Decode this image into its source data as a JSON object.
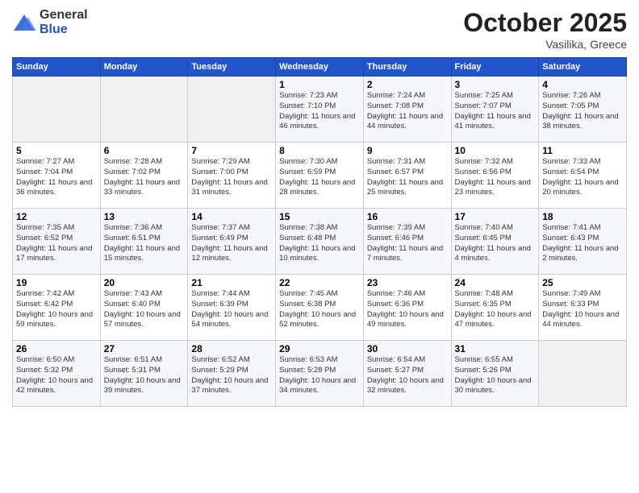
{
  "header": {
    "logo_general": "General",
    "logo_blue": "Blue",
    "month": "October 2025",
    "location": "Vasilika, Greece"
  },
  "weekdays": [
    "Sunday",
    "Monday",
    "Tuesday",
    "Wednesday",
    "Thursday",
    "Friday",
    "Saturday"
  ],
  "weeks": [
    [
      {
        "day": "",
        "sunrise": "",
        "sunset": "",
        "daylight": ""
      },
      {
        "day": "",
        "sunrise": "",
        "sunset": "",
        "daylight": ""
      },
      {
        "day": "",
        "sunrise": "",
        "sunset": "",
        "daylight": ""
      },
      {
        "day": "1",
        "sunrise": "Sunrise: 7:23 AM",
        "sunset": "Sunset: 7:10 PM",
        "daylight": "Daylight: 11 hours and 46 minutes."
      },
      {
        "day": "2",
        "sunrise": "Sunrise: 7:24 AM",
        "sunset": "Sunset: 7:08 PM",
        "daylight": "Daylight: 11 hours and 44 minutes."
      },
      {
        "day": "3",
        "sunrise": "Sunrise: 7:25 AM",
        "sunset": "Sunset: 7:07 PM",
        "daylight": "Daylight: 11 hours and 41 minutes."
      },
      {
        "day": "4",
        "sunrise": "Sunrise: 7:26 AM",
        "sunset": "Sunset: 7:05 PM",
        "daylight": "Daylight: 11 hours and 38 minutes."
      }
    ],
    [
      {
        "day": "5",
        "sunrise": "Sunrise: 7:27 AM",
        "sunset": "Sunset: 7:04 PM",
        "daylight": "Daylight: 11 hours and 36 minutes."
      },
      {
        "day": "6",
        "sunrise": "Sunrise: 7:28 AM",
        "sunset": "Sunset: 7:02 PM",
        "daylight": "Daylight: 11 hours and 33 minutes."
      },
      {
        "day": "7",
        "sunrise": "Sunrise: 7:29 AM",
        "sunset": "Sunset: 7:00 PM",
        "daylight": "Daylight: 11 hours and 31 minutes."
      },
      {
        "day": "8",
        "sunrise": "Sunrise: 7:30 AM",
        "sunset": "Sunset: 6:59 PM",
        "daylight": "Daylight: 11 hours and 28 minutes."
      },
      {
        "day": "9",
        "sunrise": "Sunrise: 7:31 AM",
        "sunset": "Sunset: 6:57 PM",
        "daylight": "Daylight: 11 hours and 25 minutes."
      },
      {
        "day": "10",
        "sunrise": "Sunrise: 7:32 AM",
        "sunset": "Sunset: 6:56 PM",
        "daylight": "Daylight: 11 hours and 23 minutes."
      },
      {
        "day": "11",
        "sunrise": "Sunrise: 7:33 AM",
        "sunset": "Sunset: 6:54 PM",
        "daylight": "Daylight: 11 hours and 20 minutes."
      }
    ],
    [
      {
        "day": "12",
        "sunrise": "Sunrise: 7:35 AM",
        "sunset": "Sunset: 6:52 PM",
        "daylight": "Daylight: 11 hours and 17 minutes."
      },
      {
        "day": "13",
        "sunrise": "Sunrise: 7:36 AM",
        "sunset": "Sunset: 6:51 PM",
        "daylight": "Daylight: 11 hours and 15 minutes."
      },
      {
        "day": "14",
        "sunrise": "Sunrise: 7:37 AM",
        "sunset": "Sunset: 6:49 PM",
        "daylight": "Daylight: 11 hours and 12 minutes."
      },
      {
        "day": "15",
        "sunrise": "Sunrise: 7:38 AM",
        "sunset": "Sunset: 6:48 PM",
        "daylight": "Daylight: 11 hours and 10 minutes."
      },
      {
        "day": "16",
        "sunrise": "Sunrise: 7:39 AM",
        "sunset": "Sunset: 6:46 PM",
        "daylight": "Daylight: 11 hours and 7 minutes."
      },
      {
        "day": "17",
        "sunrise": "Sunrise: 7:40 AM",
        "sunset": "Sunset: 6:45 PM",
        "daylight": "Daylight: 11 hours and 4 minutes."
      },
      {
        "day": "18",
        "sunrise": "Sunrise: 7:41 AM",
        "sunset": "Sunset: 6:43 PM",
        "daylight": "Daylight: 11 hours and 2 minutes."
      }
    ],
    [
      {
        "day": "19",
        "sunrise": "Sunrise: 7:42 AM",
        "sunset": "Sunset: 6:42 PM",
        "daylight": "Daylight: 10 hours and 59 minutes."
      },
      {
        "day": "20",
        "sunrise": "Sunrise: 7:43 AM",
        "sunset": "Sunset: 6:40 PM",
        "daylight": "Daylight: 10 hours and 57 minutes."
      },
      {
        "day": "21",
        "sunrise": "Sunrise: 7:44 AM",
        "sunset": "Sunset: 6:39 PM",
        "daylight": "Daylight: 10 hours and 54 minutes."
      },
      {
        "day": "22",
        "sunrise": "Sunrise: 7:45 AM",
        "sunset": "Sunset: 6:38 PM",
        "daylight": "Daylight: 10 hours and 52 minutes."
      },
      {
        "day": "23",
        "sunrise": "Sunrise: 7:46 AM",
        "sunset": "Sunset: 6:36 PM",
        "daylight": "Daylight: 10 hours and 49 minutes."
      },
      {
        "day": "24",
        "sunrise": "Sunrise: 7:48 AM",
        "sunset": "Sunset: 6:35 PM",
        "daylight": "Daylight: 10 hours and 47 minutes."
      },
      {
        "day": "25",
        "sunrise": "Sunrise: 7:49 AM",
        "sunset": "Sunset: 6:33 PM",
        "daylight": "Daylight: 10 hours and 44 minutes."
      }
    ],
    [
      {
        "day": "26",
        "sunrise": "Sunrise: 6:50 AM",
        "sunset": "Sunset: 5:32 PM",
        "daylight": "Daylight: 10 hours and 42 minutes."
      },
      {
        "day": "27",
        "sunrise": "Sunrise: 6:51 AM",
        "sunset": "Sunset: 5:31 PM",
        "daylight": "Daylight: 10 hours and 39 minutes."
      },
      {
        "day": "28",
        "sunrise": "Sunrise: 6:52 AM",
        "sunset": "Sunset: 5:29 PM",
        "daylight": "Daylight: 10 hours and 37 minutes."
      },
      {
        "day": "29",
        "sunrise": "Sunrise: 6:53 AM",
        "sunset": "Sunset: 5:28 PM",
        "daylight": "Daylight: 10 hours and 34 minutes."
      },
      {
        "day": "30",
        "sunrise": "Sunrise: 6:54 AM",
        "sunset": "Sunset: 5:27 PM",
        "daylight": "Daylight: 10 hours and 32 minutes."
      },
      {
        "day": "31",
        "sunrise": "Sunrise: 6:55 AM",
        "sunset": "Sunset: 5:26 PM",
        "daylight": "Daylight: 10 hours and 30 minutes."
      },
      {
        "day": "",
        "sunrise": "",
        "sunset": "",
        "daylight": ""
      }
    ]
  ]
}
